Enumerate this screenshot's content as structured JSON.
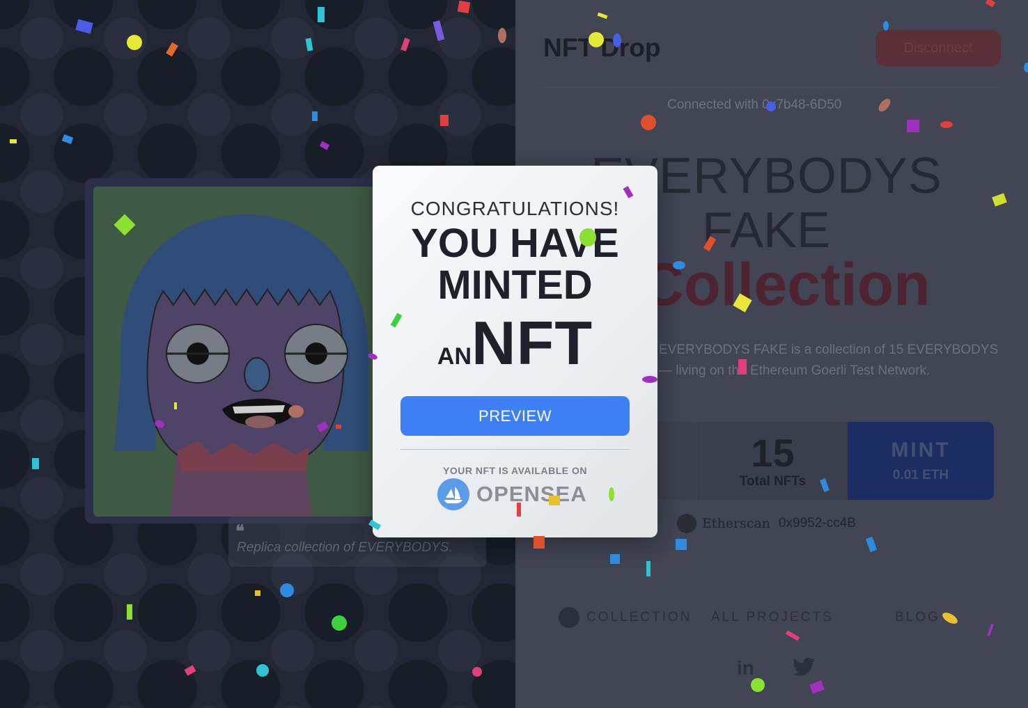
{
  "left": {
    "quote_mark": "❝",
    "quote_text": "Replica collection of EVERYBODYS."
  },
  "header": {
    "brand": "NFT Drop",
    "disconnect_label": "Disconnect",
    "connected_text": "Connected with 0x7b48-6D50"
  },
  "hero": {
    "title_line1": "EVERYBODYS",
    "title_line2": "FAKE",
    "title_line3": "Collection",
    "description": "EVERYBODYS FAKE is a collection of 15 EVERYBODYS — living on the Ethereum Goerli Test Network."
  },
  "stats": {
    "total_count": "15",
    "total_label": "Total NFTs",
    "mint_label": "MINT",
    "mint_price": "0.01 ETH"
  },
  "etherscan": {
    "name": "Etherscan",
    "address": "0x9952-cc4B"
  },
  "footer": {
    "nav": [
      "COLLECTION",
      "ALL PROJECTS",
      "BLOG"
    ],
    "social": [
      "in",
      "twitter"
    ]
  },
  "modal": {
    "congrats": "CONGRATULATIONS!",
    "headline_1": "YOU HAVE",
    "headline_2": "MINTED",
    "an": "AN",
    "nft": "NFT",
    "preview_label": "PREVIEW",
    "available_text": "YOUR NFT IS AVAILABLE ON",
    "opensea_name": "OPENSEA"
  },
  "colors": {
    "accent_blue": "#3d80f6",
    "mint_navy": "#1c2d63",
    "collection_red": "#4d2430",
    "overlay": "#414554"
  }
}
